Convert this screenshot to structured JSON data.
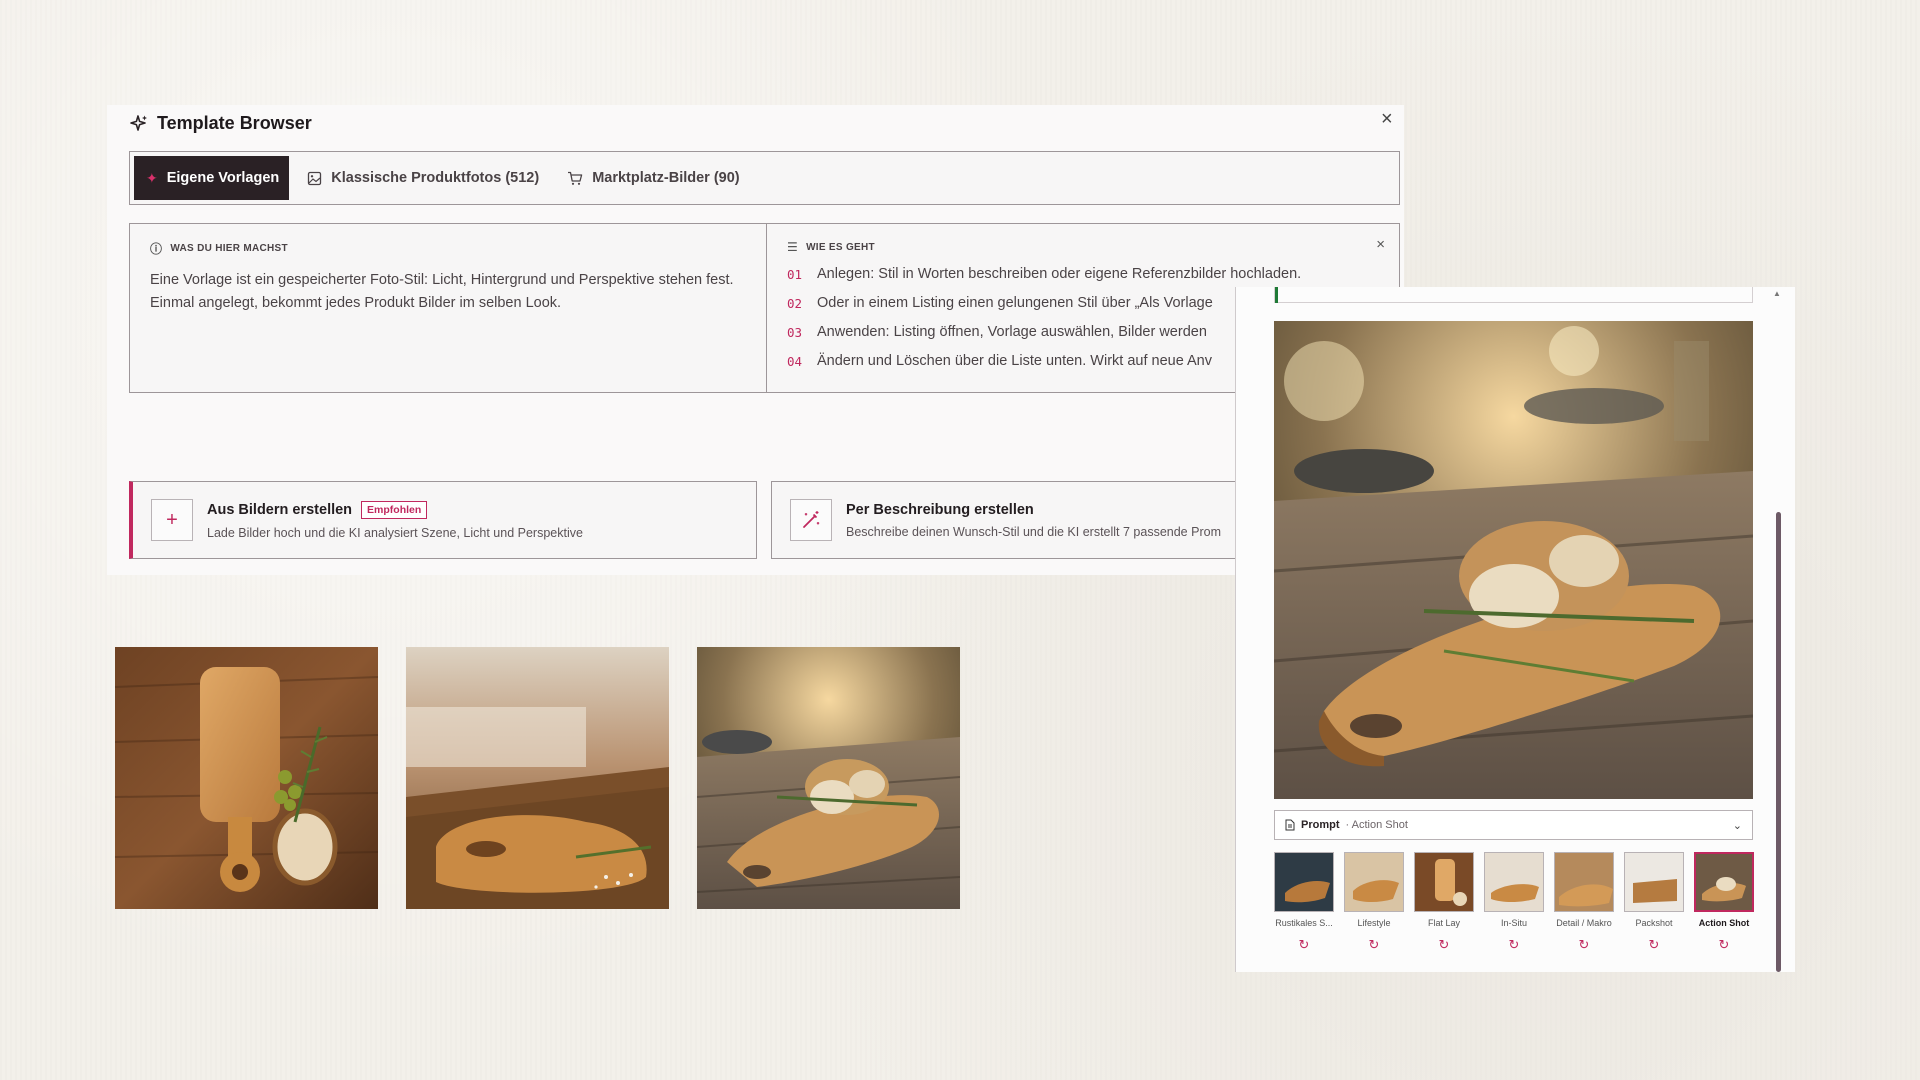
{
  "browser": {
    "title": "Template Browser",
    "tabs": [
      {
        "label": "Eigene Vorlagen",
        "active": true,
        "icon": "sparkle-icon"
      },
      {
        "label": "Klassische Produktfotos (512)",
        "icon": "image-icon"
      },
      {
        "label": "Marktplatz-Bilder (90)",
        "icon": "cart-icon"
      }
    ],
    "info": {
      "left_heading": "WAS DU HIER MACHST",
      "left_body": "Eine Vorlage ist ein gespeicherter Foto-Stil: Licht, Hintergrund und Perspektive stehen fest. Einmal angelegt, bekommt jedes Produkt Bilder im selben Look.",
      "right_heading": "WIE ES GEHT",
      "steps": [
        {
          "num": "01",
          "text": "Anlegen: Stil in Worten beschreiben oder eigene Referenzbilder hochladen."
        },
        {
          "num": "02",
          "text": "Oder in einem Listing einen gelungenen Stil über „Als Vorlage"
        },
        {
          "num": "03",
          "text": "Anwenden: Listing öffnen, Vorlage auswählen, Bilder werden"
        },
        {
          "num": "04",
          "text": "Ändern und Löschen über die Liste unten. Wirkt auf neue Anv"
        }
      ]
    },
    "cards": [
      {
        "title": "Aus Bildern erstellen",
        "badge": "Empfohlen",
        "subtitle": "Lade Bilder hoch und die KI analysiert Szene, Licht und Perspektive",
        "icon": "plus-icon"
      },
      {
        "title": "Per Beschreibung erstellen",
        "subtitle": "Beschreibe deinen Wunsch-Stil und die KI erstellt 7 passende Prom",
        "icon": "magic-wand-icon"
      }
    ]
  },
  "thumbnails": [
    {
      "name": "flat-lay-board",
      "desc": "Schneidebrett mit Brot und Oliven"
    },
    {
      "name": "kitchen-board",
      "desc": "Schneidebrett in der Küche"
    },
    {
      "name": "action-board",
      "desc": "Schneidebrett mit Brot im Freien"
    }
  ],
  "detail": {
    "prompt_label": "Prompt",
    "prompt_value": "· Action Shot",
    "variants": [
      {
        "label": "Rustikales S...",
        "selected": false
      },
      {
        "label": "Lifestyle",
        "selected": false
      },
      {
        "label": "Flat Lay",
        "selected": false
      },
      {
        "label": "In-Situ",
        "selected": false
      },
      {
        "label": "Detail / Makro",
        "selected": false
      },
      {
        "label": "Packshot",
        "selected": false
      },
      {
        "label": "Action Shot",
        "selected": true
      }
    ],
    "regen_icon": "refresh-icon"
  },
  "colors": {
    "accent": "#c0285e",
    "dark": "#2a2125",
    "success": "#1e7a36"
  }
}
